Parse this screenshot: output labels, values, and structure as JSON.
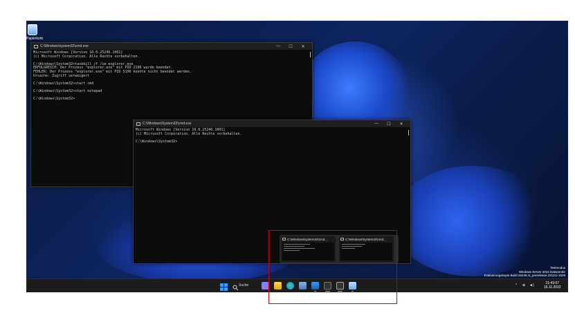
{
  "desktop": {
    "recycle_bin_label": "Papierkorb"
  },
  "window1": {
    "title": "C:\\Windows\\system32\\cmd.exe",
    "terminal_text": "Microsoft Windows [Version 10.0.25246.1001]\n(c) Microsoft Corporation. Alle Rechte vorbehalten.\n\nC:\\Windows\\System32>taskkill /f /im explorer.exe\nERFOLGREICH: Der Prozess \"explorer.exe\" mit PID 2196 wurde beendet.\nFEHLER: Der Prozess \"explorer.exe\" mit PID 5196 konnte nicht beendet werden.\nUrsache: Zugriff verweigert\n\nC:\\Windows\\System32>start cmd\n\nC:\\Windows\\System32>start notepad\n\nC:\\Windows\\System32>"
  },
  "window2": {
    "title": "C:\\Windows\\System32\\cmd.exe",
    "terminal_text": "Microsoft Windows [Version 10.0.25246.1001]\n(c) Microsoft Corporation. Alle Rechte vorbehalten.\n\nC:\\Windows\\System32>"
  },
  "window_controls": {
    "minimize": "—",
    "maximize": "☐",
    "close": "✕"
  },
  "taskbar": {
    "search_label": "Suche",
    "time": "21:43:07",
    "date": "16.11.2022",
    "tray_icons": [
      "chevron-up-icon",
      "network-icon",
      "volume-icon"
    ]
  },
  "preview": {
    "thumb1_title": "C:\\Windows\\system32\\cmd...",
    "thumb2_title": "C:\\Windows\\System32\\cmd..."
  },
  "watermark": {
    "line1": "Testmodus",
    "line2": "Windows Server 2022 Datacenter",
    "line3": "Evaluierungskopie Build 25246.rs_prerelease.221111-1529"
  }
}
